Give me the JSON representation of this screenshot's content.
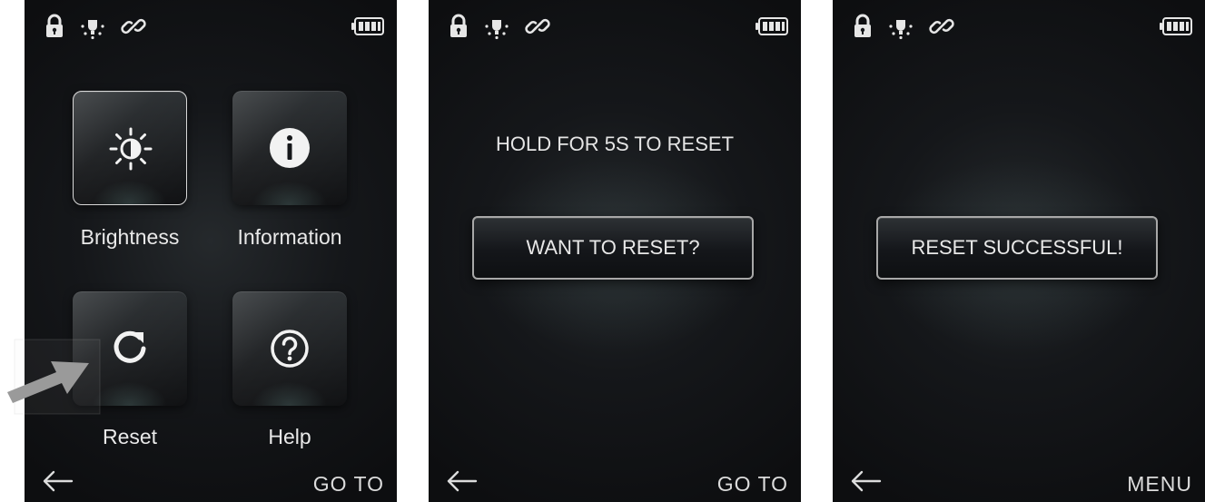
{
  "colors": {
    "screen_background": "#15171a",
    "text": "#e7e7e7",
    "tile_border_selected": "#d9d9d9",
    "button_border": "#a8a8a8",
    "pointer_arrow": "#999999"
  },
  "status_bar": {
    "icons": [
      "lock-icon",
      "light-icon",
      "link-icon",
      "battery-icon"
    ]
  },
  "screens": [
    {
      "id": "menu",
      "tiles": [
        {
          "label": "Brightness",
          "icon": "brightness-icon",
          "selected": true
        },
        {
          "label": "Information",
          "icon": "info-icon",
          "selected": false
        },
        {
          "label": "Reset",
          "icon": "reset-icon",
          "selected": false
        },
        {
          "label": "Help",
          "icon": "help-icon",
          "selected": false
        }
      ],
      "back_icon": "back-arrow-icon",
      "action_label": "GO TO"
    },
    {
      "id": "reset-confirm",
      "prompt": "HOLD FOR 5S TO RESET",
      "button_label": "WANT TO RESET?",
      "back_icon": "back-arrow-icon",
      "action_label": "GO TO"
    },
    {
      "id": "reset-done",
      "button_label": "RESET SUCCESSFUL!",
      "back_icon": "back-arrow-icon",
      "action_label": "MENU"
    }
  ],
  "pointer": {
    "icon": "pointer-arrow-icon",
    "target": "Reset"
  }
}
